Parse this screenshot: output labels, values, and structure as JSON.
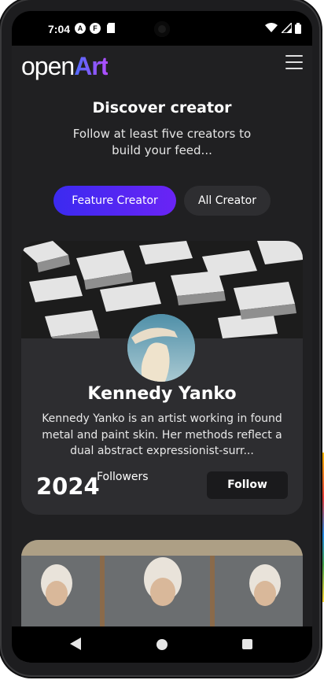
{
  "status_bar": {
    "time": "7:04",
    "icons": [
      "a-icon",
      "f-icon",
      "sd-card-icon"
    ],
    "right_icons": [
      "wifi-icon",
      "signal-icon",
      "battery-icon"
    ]
  },
  "app": {
    "logo_open": "open",
    "logo_art": "Art",
    "menu_icon": "hamburger-menu-icon"
  },
  "page": {
    "title": "Discover creator",
    "subtitle": "Follow at least five creators to build your feed..."
  },
  "tabs": [
    {
      "label": "Feature Creator",
      "active": true
    },
    {
      "label": "All Creator",
      "active": false
    }
  ],
  "creator_card": {
    "name": "Kennedy Yanko",
    "bio": "Kennedy Yanko is an artist working in found metal and paint skin. Her methods reflect a dual abstract expressionist-surr...",
    "followers_count": "2024",
    "followers_label": "Followers",
    "follow_label": "Follow"
  },
  "colors": {
    "background": "#202022",
    "card": "#2d2d30",
    "accent_start": "#3b2af0",
    "accent_end": "#6a24f5"
  }
}
